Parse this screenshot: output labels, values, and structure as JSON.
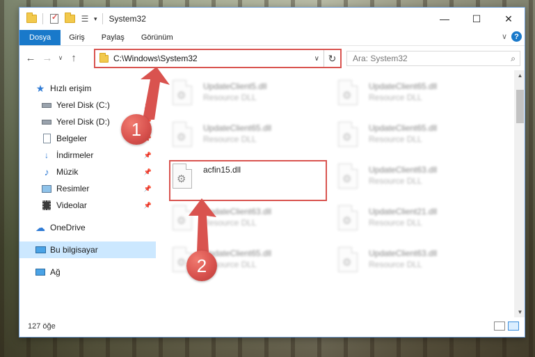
{
  "window": {
    "title": "System32",
    "minimize_glyph": "—",
    "maximize_glyph": "☐",
    "close_glyph": "✕"
  },
  "ribbon": {
    "tabs": [
      "Dosya",
      "Giriş",
      "Paylaş",
      "Görünüm"
    ],
    "help_glyph": "?",
    "collapse_glyph": "∨"
  },
  "nav": {
    "back_glyph": "←",
    "forward_glyph": "→",
    "recent_glyph": "∨",
    "up_glyph": "↑"
  },
  "address": {
    "path": "C:\\Windows\\System32",
    "caret_glyph": "∨",
    "refresh_glyph": "↻"
  },
  "search": {
    "placeholder": "Ara: System32",
    "icon_glyph": "⌕"
  },
  "navpane": {
    "quick_access": "Hızlı erişim",
    "items": [
      {
        "label": "Yerel Disk (C:)",
        "icon": "drive-icon"
      },
      {
        "label": "Yerel Disk (D:)",
        "icon": "drive-icon"
      },
      {
        "label": "Belgeler",
        "icon": "documents-icon"
      },
      {
        "label": "İndirmeler",
        "icon": "downloads-icon"
      },
      {
        "label": "Müzik",
        "icon": "music-icon"
      },
      {
        "label": "Resimler",
        "icon": "pictures-icon"
      },
      {
        "label": "Videolar",
        "icon": "videos-icon"
      }
    ],
    "onedrive": "OneDrive",
    "this_pc": "Bu bilgisayar",
    "network": "Ağ"
  },
  "files": [
    {
      "name": "UpdateClient5.dll",
      "type": "Resource DLL",
      "blurred": true
    },
    {
      "name": "UpdateClient65.dll",
      "type": "Resource DLL",
      "blurred": true
    },
    {
      "name": "UpdateClient65.dll",
      "type": "Resource DLL",
      "blurred": true
    },
    {
      "name": "UpdateClient65.dll",
      "type": "Resource DLL",
      "blurred": true
    },
    {
      "name": "acfin15.dll",
      "type": "",
      "blurred": false
    },
    {
      "name": "UpdateClient63.dll",
      "type": "Resource DLL",
      "blurred": true
    },
    {
      "name": "UpdateClient63.dll",
      "type": "Resource DLL",
      "blurred": true
    },
    {
      "name": "UpdateClient21.dll",
      "type": "Resource DLL",
      "blurred": true
    },
    {
      "name": "UpdateClient65.dll",
      "type": "Resource DLL",
      "blurred": true
    },
    {
      "name": "UpdateClient63.dll",
      "type": "Resource DLL",
      "blurred": true
    }
  ],
  "status": {
    "item_count": "127 öğe"
  },
  "annotations": {
    "badge1": "1",
    "badge2": "2",
    "color": "#d9534f"
  }
}
